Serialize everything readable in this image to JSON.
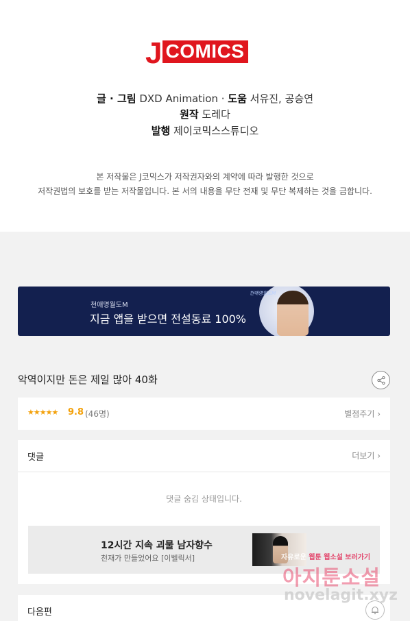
{
  "credits": {
    "logo": {
      "j": "J",
      "box": "COMICS"
    },
    "line1": {
      "key": "글 · 그림",
      "value": "DXD Animation",
      "sep": " · ",
      "key2": "도움",
      "value2": "서유진, 공승연"
    },
    "line2": {
      "key": "원작",
      "value": "도레다"
    },
    "line3": {
      "key": "발행",
      "value": "제이코믹스스튜디오"
    },
    "notice1": "본 저작물은 J코믹스가 저작권자와의 계약에 따라 발행한 것으로",
    "notice2": "저작권법의 보호를 받는 저작물입니다. 본 서의 내용을 무단 전재 및 무단 복제하는 것을 금합니다."
  },
  "banner": {
    "small": "천애명월도M",
    "big": "지금 앱을 받으면 전설동료 100%",
    "logo": "천애명월도M"
  },
  "episode": {
    "title": "악역이지만 돈은 제일 많아 40화"
  },
  "rating": {
    "stars": "★★★★★",
    "score": "9.8",
    "count": "(46명)",
    "rate_link": "별점주기 ›"
  },
  "comments": {
    "header": "댓글",
    "more": "더보기 ›",
    "hidden_msg": "댓글 숨김 상태입니다."
  },
  "ad": {
    "title": "12시간 지속 괴물 남자향수",
    "subtitle": "천재가 만들었어요 [이벨릭서]"
  },
  "next": {
    "label": "다음편"
  },
  "watermark": {
    "top_a": "자유로운 ",
    "top_b": "웹툰",
    "top_c": " 웹소설 ",
    "top_d": "보러가기",
    "main": "아지툰소설",
    "url": "novelagit.xyz"
  },
  "colors": {
    "brand_red": "#e0161e",
    "rating_orange": "#f3a10b",
    "banner_navy": "#13204f"
  }
}
